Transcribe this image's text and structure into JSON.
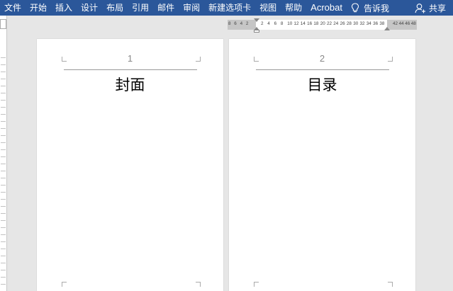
{
  "ribbon": {
    "tabs": [
      "文件",
      "开始",
      "插入",
      "设计",
      "布局",
      "引用",
      "邮件",
      "审阅",
      "新建选项卡",
      "视图",
      "帮助",
      "Acrobat"
    ],
    "tell_me": "告诉我",
    "share": "共享"
  },
  "ruler": {
    "left_numbers": [
      "8",
      "6",
      "4",
      "2"
    ],
    "main_numbers": [
      "2",
      "4",
      "6",
      "8",
      "10",
      "12",
      "14",
      "16",
      "18",
      "20",
      "22",
      "24",
      "26",
      "28",
      "30",
      "32",
      "34",
      "36",
      "38"
    ],
    "right_numbers": [
      "42",
      "44",
      "46",
      "48"
    ]
  },
  "pages": [
    {
      "number": "1",
      "title": "封面"
    },
    {
      "number": "2",
      "title": "目录"
    }
  ],
  "colors": {
    "ribbon": "#2b579a",
    "workspace": "#e6e6e6"
  }
}
